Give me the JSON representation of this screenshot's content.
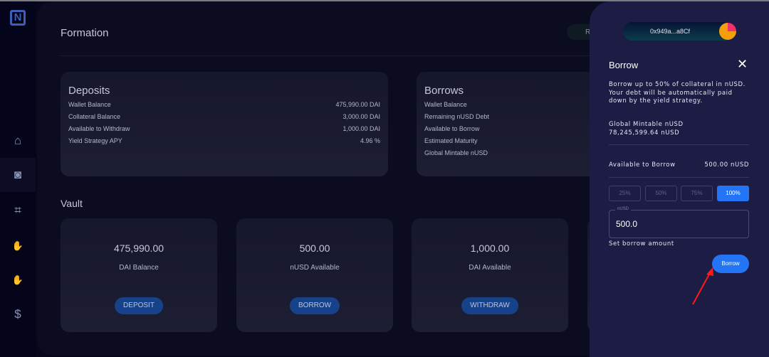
{
  "sidebar": {
    "logo": "N",
    "items": [
      {
        "icon": "home-icon",
        "glyph": "⌂"
      },
      {
        "icon": "vault-icon",
        "glyph": "◙",
        "active": true
      },
      {
        "icon": "crop-icon",
        "glyph": "⌗"
      },
      {
        "icon": "hand-deposit-icon",
        "glyph": "✋"
      },
      {
        "icon": "hand-coin-icon",
        "glyph": "✋"
      },
      {
        "icon": "dollar-icon",
        "glyph": "$"
      }
    ]
  },
  "header": {
    "title": "Formation",
    "button_partial": "R"
  },
  "deposits": {
    "title": "Deposits",
    "rows": [
      {
        "label": "Wallet Balance",
        "value": "475,990.00 DAI"
      },
      {
        "label": "Collateral Balance",
        "value": "3,000.00 DAI"
      },
      {
        "label": "Available to Withdraw",
        "value": "1,000.00 DAI"
      },
      {
        "label": "Yield Strategy APY",
        "value": "4.96 %"
      }
    ]
  },
  "borrows": {
    "title": "Borrows",
    "rows": [
      {
        "label": "Wallet Balance"
      },
      {
        "label": "Remaining nUSD Debt"
      },
      {
        "label": "Available to Borrow"
      },
      {
        "label": "Estimated Maturity"
      },
      {
        "label": "Global Mintable nUSD"
      }
    ]
  },
  "vault": {
    "title": "Vault",
    "cards": [
      {
        "amount": "475,990.00",
        "label": "DAI Balance",
        "button": "DEPOSIT"
      },
      {
        "amount": "500.00",
        "label": "nUSD Available",
        "button": "BORROW"
      },
      {
        "amount": "1,000.00",
        "label": "DAI Available",
        "button": "WITHDRAW"
      }
    ]
  },
  "panel": {
    "wallet": "0x949a...a8Cf",
    "title": "Borrow",
    "description_lines": [
      "Borrow up to 50% of collateral in nUSD.",
      "Your debt will be automatically paid",
      "down by the yield strategy."
    ],
    "global_label": "Global Mintable nUSD",
    "global_value": "78,245,599.64 nUSD",
    "available_label": "Available to Borrow",
    "available_value": "500.00 nUSD",
    "percent_options": [
      "25%",
      "50%",
      "75%",
      "100%"
    ],
    "selected_percent": "100%",
    "input_legend": "nUSD",
    "input_value": "500.0",
    "helper": "Set borrow amount",
    "submit": "Borrow"
  },
  "colors": {
    "accent": "#2375f5",
    "panel": "#1c1c44",
    "annotation_arrow": "#ff1a1a"
  }
}
